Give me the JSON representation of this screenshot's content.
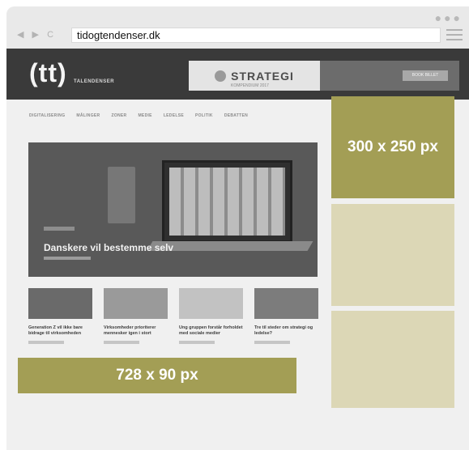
{
  "browser": {
    "url": "tidogtendenser.dk",
    "dots": "●●●",
    "nav": {
      "back": "◀",
      "forward": "▶",
      "reload": "C"
    }
  },
  "site": {
    "logo": "(tt)",
    "logo_sub": "TALENDENSER",
    "header_ad": {
      "word": "STRATEGI",
      "tagline": "KOMPENDIUM 2017"
    },
    "promo_button": "BOOK BILLET",
    "topnav": [
      "DIGITALISERING",
      "MÅLINGER",
      "ZONER",
      "MEDIE",
      "LEDELSE",
      "POLITIK",
      "DEBATTEN"
    ],
    "hero_title": "Danskere vil bestemme selv",
    "cards": [
      {
        "title": "Generation Z vil ikke bare bidrage til virksomheden"
      },
      {
        "title": "Virksomheder prioriterer mennesker igen i stort"
      },
      {
        "title": "Ung gruppen forstår forholdet med sociale medier"
      },
      {
        "title": "Tre til steder om strategi og ledelse?"
      }
    ]
  },
  "ads": {
    "leaderboard_label": "728 x 90 px",
    "rectangle_label": "300 x 250 px"
  },
  "colors": {
    "accent": "#a39e55",
    "accent_light": "#dcd7b6",
    "header_bg": "#3a3a3a"
  }
}
